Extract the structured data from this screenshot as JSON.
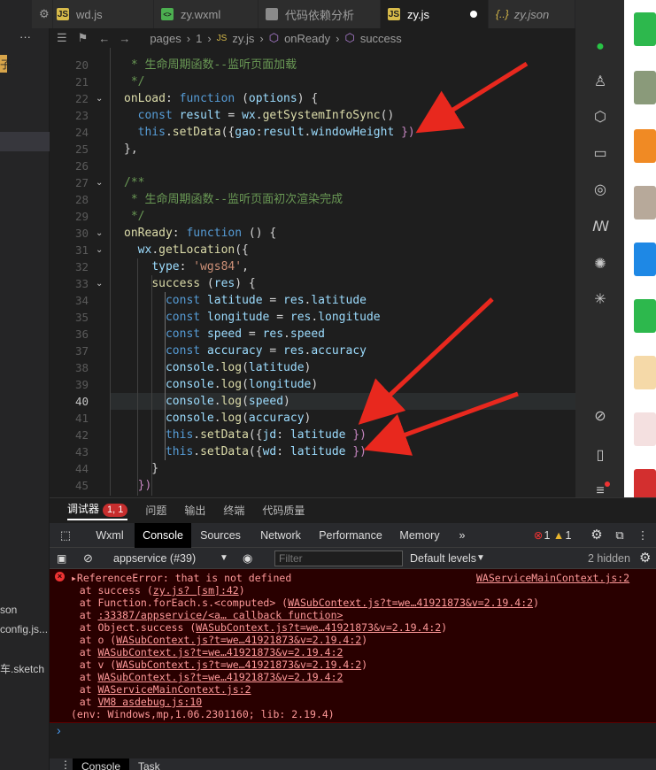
{
  "sidebar": {
    "items": [
      {
        "label": "子"
      },
      {
        "label": "son"
      },
      {
        "label": "config.js..."
      },
      {
        "label": "车.sketch"
      }
    ],
    "menu_icon": "more-icon"
  },
  "tabs": [
    {
      "label": "wd.js",
      "icon": "JS"
    },
    {
      "label": "zy.wxml",
      "icon": "<>"
    },
    {
      "label": "代码依赖分析",
      "icon": ""
    },
    {
      "label": "zy.js",
      "icon": "JS",
      "active": true
    },
    {
      "label": "zy.json",
      "icon": "{..}"
    }
  ],
  "breadcrumb": {
    "items": [
      "pages",
      "1",
      "zy.js",
      "onReady",
      "success"
    ]
  },
  "editor": {
    "current_line": "40",
    "lines": [
      {
        "n": "20",
        "html": "<span class='cm'> * 生命周期函数--监听页面加载</span>"
      },
      {
        "n": "21",
        "html": "<span class='cm'> */</span>"
      },
      {
        "n": "22",
        "html": "<span class='fn'>onLoad</span>: <span class='kw'>function</span> (<span class='vr'>options</span>) {",
        "fold": true
      },
      {
        "n": "23",
        "html": "  <span class='kw'>const</span> <span class='vr'>result</span> = <span class='vr'>wx</span>.<span class='fn'>getSystemInfoSync</span>()"
      },
      {
        "n": "24",
        "html": "  <span class='kw'>this</span>.<span class='fn'>setData</span>({<span class='vr'>gao</span>:<span class='vr'>result</span>.<span class='vr'>windowHeight</span> <span class='pl'>})</span>"
      },
      {
        "n": "25",
        "html": "},"
      },
      {
        "n": "26",
        "html": ""
      },
      {
        "n": "27",
        "html": "<span class='cm'>/**</span>",
        "fold": true
      },
      {
        "n": "28",
        "html": "<span class='cm'> * 生命周期函数--监听页面初次渲染完成</span>"
      },
      {
        "n": "29",
        "html": "<span class='cm'> */</span>"
      },
      {
        "n": "30",
        "html": "<span class='fn'>onReady</span>: <span class='kw'>function</span> () {",
        "fold": true
      },
      {
        "n": "31",
        "html": "  <span class='vr'>wx</span>.<span class='fn'>getLocation</span>({",
        "fold": true
      },
      {
        "n": "32",
        "html": "    <span class='vr'>type</span>: <span class='st'>'wgs84'</span>,"
      },
      {
        "n": "33",
        "html": "    <span class='fn'>success</span> (<span class='vr'>res</span>) {",
        "fold": true
      },
      {
        "n": "34",
        "html": "      <span class='kw'>const</span> <span class='vr'>latitude</span> = <span class='vr'>res</span>.<span class='vr'>latitude</span>"
      },
      {
        "n": "35",
        "html": "      <span class='kw'>const</span> <span class='vr'>longitude</span> = <span class='vr'>res</span>.<span class='vr'>longitude</span>"
      },
      {
        "n": "36",
        "html": "      <span class='kw'>const</span> <span class='vr'>speed</span> = <span class='vr'>res</span>.<span class='vr'>speed</span>"
      },
      {
        "n": "37",
        "html": "      <span class='kw'>const</span> <span class='vr'>accuracy</span> = <span class='vr'>res</span>.<span class='vr'>accuracy</span>"
      },
      {
        "n": "38",
        "html": "      <span class='vr'>console</span>.<span class='fn'>log</span>(<span class='vr'>latitude</span>)"
      },
      {
        "n": "39",
        "html": "      <span class='vr'>console</span>.<span class='fn'>log</span>(<span class='vr'>longitude</span>)"
      },
      {
        "n": "40",
        "html": "      <span class='vr'>console</span>.<span class='fn'>log</span>(<span class='vr'>speed</span>)"
      },
      {
        "n": "41",
        "html": "      <span class='vr'>console</span>.<span class='fn'>log</span>(<span class='vr'>accuracy</span>)"
      },
      {
        "n": "42",
        "html": "      <span class='kw'>this</span>.<span class='fn'>setData</span>({<span class='vr'>jd</span>: <span class='vr'>latitude</span> <span class='pl'>})</span>"
      },
      {
        "n": "43",
        "html": "      <span class='kw'>this</span>.<span class='fn'>setData</span>({<span class='vr'>wd</span>: <span class='vr'>latitude</span> <span class='pl'>})</span>"
      },
      {
        "n": "44",
        "html": "    }"
      },
      {
        "n": "45",
        "html": "  <span class='pl'>})</span>"
      }
    ]
  },
  "debugger": {
    "tabs": [
      "调试器",
      "问题",
      "输出",
      "终端",
      "代码质量"
    ],
    "error_badge": "1, 1"
  },
  "devtools": {
    "tabs": [
      "Wxml",
      "Console",
      "Sources",
      "Network",
      "Performance",
      "Memory"
    ],
    "more": "»",
    "errors": "1",
    "warnings": "1"
  },
  "filter": {
    "context": "appservice (#39)",
    "placeholder": "Filter",
    "levels": "Default levels",
    "hidden": "2 hidden"
  },
  "console": {
    "source": "WAServiceMainContext.js:2",
    "lines": [
      "▸ReferenceError: that is not defined",
      "    at success (<u>zy.js? [sm]:42</u>)",
      "    at Function.forEach.s.<computed> (<u>WASubContext.js?t=we…41921873&v=2.19.4:2</u>)",
      "    at <u>:33387/appservice/<a… callback function></u>",
      "    at Object.success (<u>WASubContext.js?t=we…41921873&v=2.19.4:2</u>)",
      "    at o (<u>WASubContext.js?t=we…41921873&v=2.19.4:2</u>)",
      "    at <u>WASubContext.js?t=we…41921873&v=2.19.4:2</u>",
      "    at v (<u>WASubContext.js?t=we…41921873&v=2.19.4:2</u>)",
      "    at <u>WASubContext.js?t=we…41921873&v=2.19.4:2</u>",
      "    at <u>WAServiceMainContext.js:2</u>",
      "    at <u>VM8 asdebug.js:10</u>",
      "(env: Windows,mp,1.06.2301160; lib: 2.19.4)"
    ],
    "prompt": "›"
  },
  "bottom": {
    "tabs": [
      "Console",
      "Task"
    ]
  },
  "colors": {
    "arrow": "#e8281e",
    "error_bg": "#290000",
    "accent": "#4a9ef8"
  }
}
